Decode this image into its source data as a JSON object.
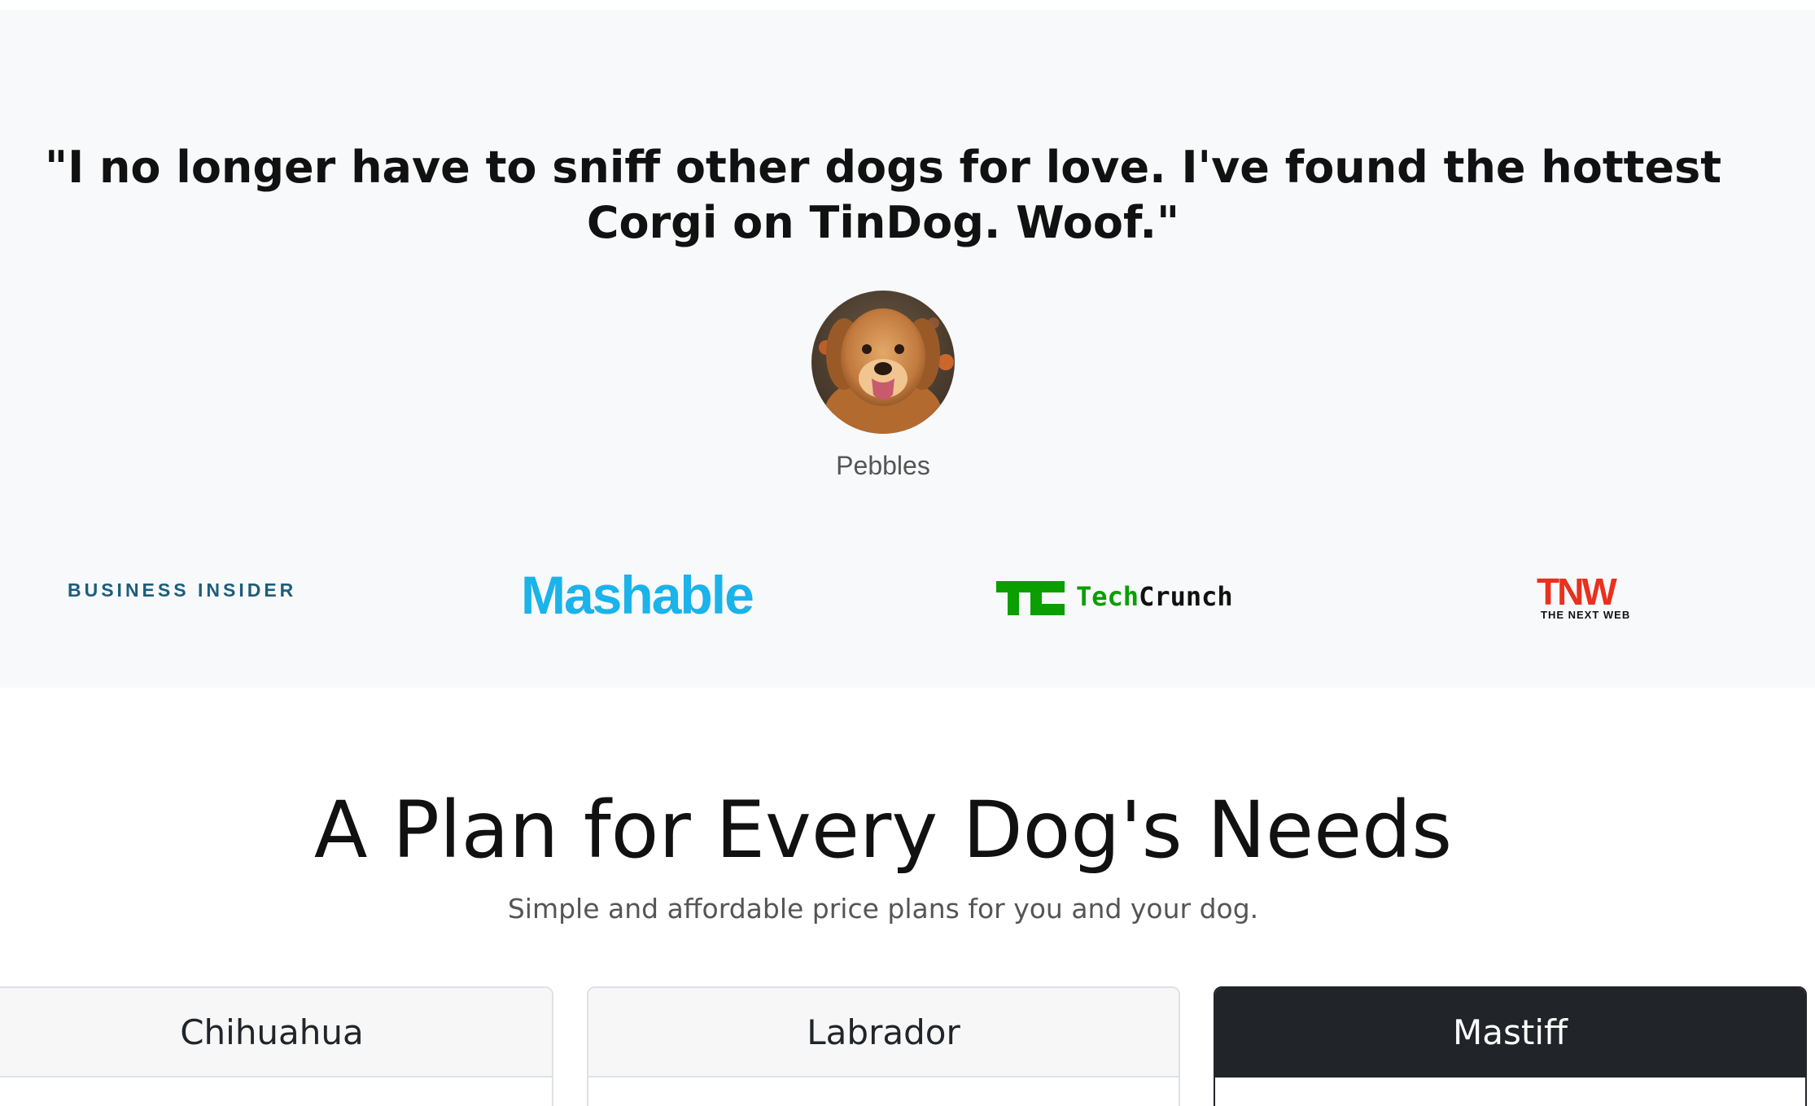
{
  "testimonial": {
    "quote": "\"I no longer have to sniff other dogs for love. I've found the hottest Corgi on TinDog. Woof.\"",
    "author": "Pebbles",
    "avatar_icon": "dog-photo-avatar"
  },
  "press": {
    "logos": [
      {
        "name": "business-insider",
        "text": "BUSINESS INSIDER",
        "color": "#1c5d7d"
      },
      {
        "name": "mashable",
        "text": "Mashable",
        "color": "#1ab3ea"
      },
      {
        "name": "techcrunch",
        "mark": "TC",
        "text_a": "Tech",
        "text_b": "Crunch",
        "color": "#0a9e01"
      },
      {
        "name": "tnw",
        "mark": "TNW",
        "text": "THE NEXT WEB",
        "color": "#e8311e"
      }
    ]
  },
  "pricing": {
    "title": "A Plan for Every Dog's Needs",
    "subtitle": "Simple and affordable price plans for you and your dog.",
    "plans": [
      {
        "name": "Chihuahua"
      },
      {
        "name": "Labrador"
      },
      {
        "name": "Mastiff"
      }
    ]
  },
  "colors": {
    "section_bg": "#f8f9fa",
    "dark": "#212529",
    "card_header": "#f7f7f7"
  }
}
